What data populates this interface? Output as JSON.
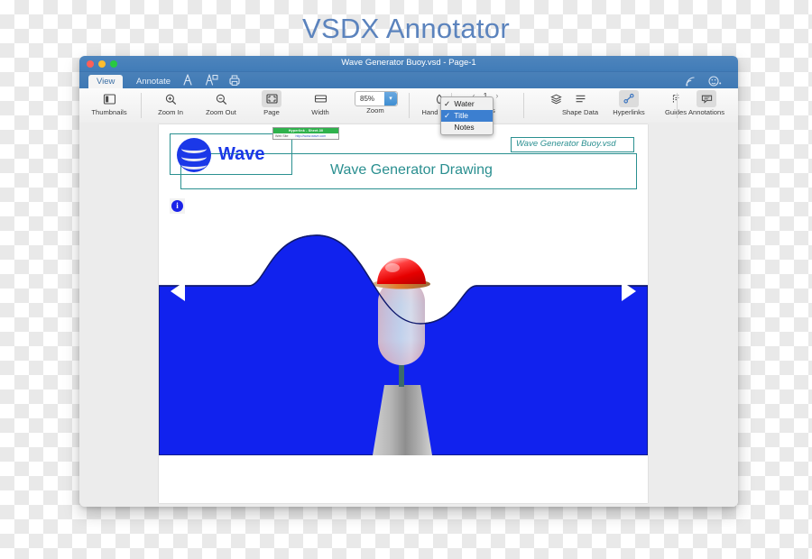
{
  "page": {
    "heading": "VSDX Annotator"
  },
  "window": {
    "title": "Wave Generator Buoy.vsd - Page-1",
    "traffic_lights": [
      "close",
      "minimize",
      "zoom"
    ],
    "accent_color": "#4178b4"
  },
  "tabs": [
    {
      "label": "View",
      "active": true
    },
    {
      "label": "Annotate",
      "active": false
    }
  ],
  "tab_icons": [
    {
      "name": "export-pdf-icon"
    },
    {
      "name": "export-pdf-annotations-icon"
    },
    {
      "name": "print-icon"
    },
    {
      "name": "share-icon"
    },
    {
      "name": "emoji-icon"
    }
  ],
  "toolbar": {
    "items": [
      {
        "label": "Thumbnails",
        "icon": "thumbnails-icon",
        "active": false
      },
      {
        "label": "Zoom In",
        "icon": "zoom-in-icon",
        "active": false
      },
      {
        "label": "Zoom Out",
        "icon": "zoom-out-icon",
        "active": false
      },
      {
        "label": "Page",
        "icon": "fit-page-icon",
        "active": true
      },
      {
        "label": "Width",
        "icon": "fit-width-icon",
        "active": false
      },
      {
        "label": "Zoom",
        "icon": "zoom-combo",
        "active": false
      },
      {
        "label": "Hand Scroll",
        "icon": "hand-scroll-icon",
        "active": false
      },
      {
        "label": "Pages",
        "icon": "pages-nav",
        "active": false
      },
      {
        "label": "Layers",
        "icon": "layers-icon",
        "active": false
      },
      {
        "label": "Shape Data",
        "icon": "shape-data-icon",
        "active": false
      },
      {
        "label": "Hyperlinks",
        "icon": "hyperlinks-icon",
        "active": true
      },
      {
        "label": "Guides",
        "icon": "guides-icon",
        "active": false
      },
      {
        "label": "Annotations",
        "icon": "annotations-icon",
        "active": false
      }
    ],
    "zoom_value": "85%",
    "page_number": "1",
    "prev_page_glyph": "‹",
    "next_page_glyph": "›"
  },
  "layers_menu": {
    "items": [
      {
        "label": "Water",
        "checked": true,
        "selected": false
      },
      {
        "label": "Title",
        "checked": true,
        "selected": true
      },
      {
        "label": "Notes",
        "checked": false,
        "selected": false
      }
    ],
    "check_glyph": "✓",
    "highlight_color": "#3c7fd0"
  },
  "document": {
    "logo_text": "Wave",
    "drawing_title": "Wave Generator Drawing",
    "file_label": "Wave Generator Buoy.vsd",
    "annotation_color": "#2a9090",
    "info_glyph": "i",
    "hyperlink_tooltip": {
      "header": "Hyperlink - Sheet.30",
      "field": "Web Site",
      "url": "http://www.wave.com"
    }
  },
  "drawing": {
    "water_color": "#1122ee",
    "buoy_dome_color": "#ee1111",
    "buoy_collar_color": "#d2773a",
    "anchor_color": "#a8a8a8",
    "stem_color": "#3b6b6b",
    "nav_prev_glyph": "◀",
    "nav_next_glyph": "▶"
  }
}
